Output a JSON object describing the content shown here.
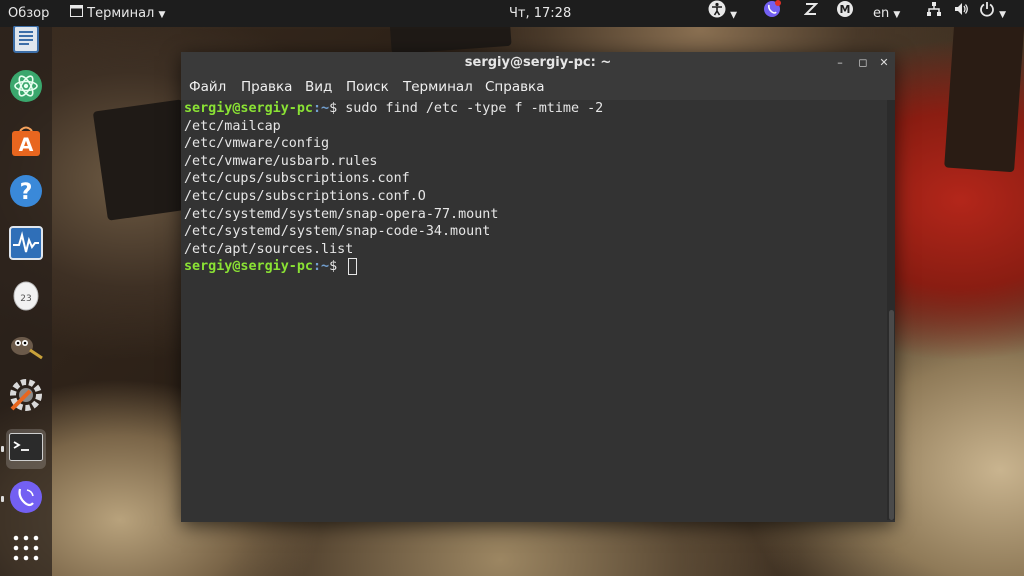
{
  "topbar": {
    "activities": "Обзор",
    "app_menu": "Терминал",
    "clock": "Чт, 17:28",
    "lang": "en"
  },
  "dock": {
    "items": [
      {
        "icon": "document-viewer-icon"
      },
      {
        "icon": "atom-icon"
      },
      {
        "icon": "software-center-icon"
      },
      {
        "icon": "help-icon"
      },
      {
        "icon": "system-monitor-icon"
      },
      {
        "icon": "egg-app-icon"
      },
      {
        "icon": "gimp-icon"
      },
      {
        "icon": "settings-icon"
      },
      {
        "icon": "terminal-icon"
      },
      {
        "icon": "viber-icon"
      },
      {
        "icon": "app-grid-icon"
      }
    ]
  },
  "window": {
    "title": "sergiy@sergiy-pc: ~",
    "menu": [
      "Файл",
      "Правка",
      "Вид",
      "Поиск",
      "Терминал",
      "Справка"
    ],
    "prompt_user": "sergiy@sergiy-pc",
    "prompt_path": ":~",
    "prompt_symbol": "$ ",
    "command": "sudo find /etc -type f -mtime -2",
    "output": [
      "/etc/mailcap",
      "/etc/vmware/config",
      "/etc/vmware/usbarb.rules",
      "/etc/cups/subscriptions.conf",
      "/etc/cups/subscriptions.conf.O",
      "/etc/systemd/system/snap-opera-77.mount",
      "/etc/systemd/system/snap-code-34.mount",
      "/etc/apt/sources.list"
    ]
  },
  "colors": {
    "prompt_user": "#8ae234",
    "prompt_path": "#729fcf",
    "terminal_bg": "#333333"
  }
}
